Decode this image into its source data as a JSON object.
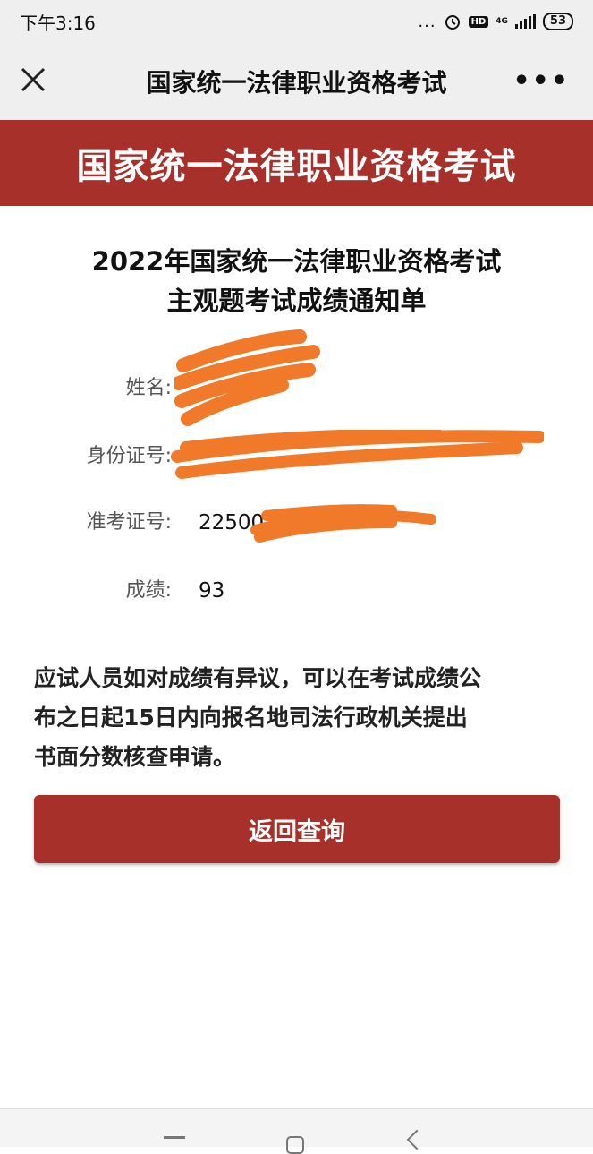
{
  "status_bar": {
    "time": "下午3:16",
    "more": "...",
    "network": "4G",
    "hd": "HD",
    "battery": "53"
  },
  "nav": {
    "title": "国家统一法律职业资格考试",
    "close_icon": "close-icon",
    "more_icon": "more-icon"
  },
  "banner": {
    "text": "国家统一法律职业资格考试",
    "color": "#a8302a"
  },
  "doc": {
    "title_line1": "2022年国家统一法律职业资格考试",
    "title_line2": "主观题考试成绩通知单"
  },
  "fields": {
    "name_label": "姓名:",
    "id_label": "身份证号:",
    "ticket_label": "准考证号:",
    "ticket_value": "22500",
    "score_label": "成绩:",
    "score_value": "93"
  },
  "notice": {
    "line1": "应试人员如对成绩有异议，可以在考试成绩公",
    "line2": "布之日起15日内向报名地司法行政机关提出",
    "line3": "书面分数核查申请。"
  },
  "button": {
    "back_label": "返回查询"
  },
  "redaction_color": "#f07a2a"
}
